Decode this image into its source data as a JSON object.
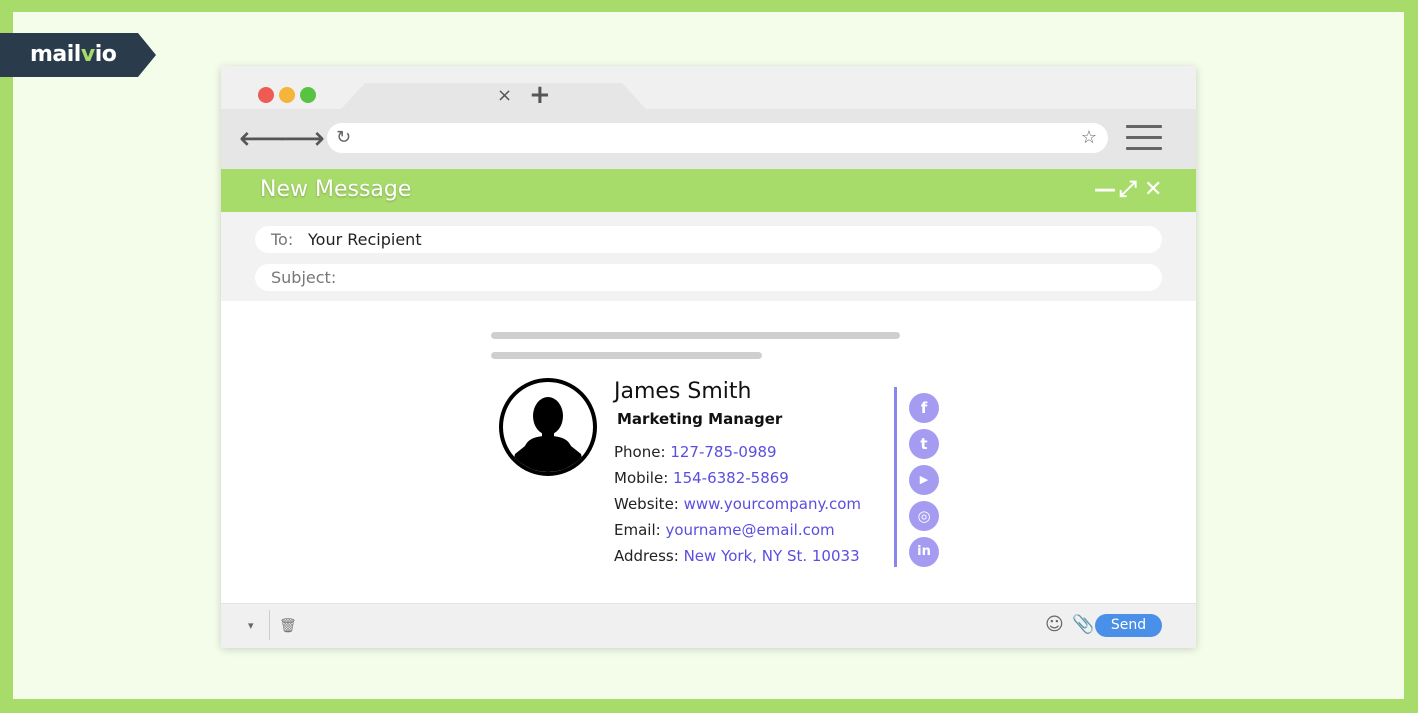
{
  "brand": {
    "logo_text_a": "mail",
    "logo_text_b": "v",
    "logo_text_c": "io"
  },
  "browser": {
    "tab_close": "×",
    "tab_new": "+",
    "back_icon": "arrow-left-icon",
    "forward_icon": "arrow-right-icon",
    "reload_icon": "reload-icon",
    "star_icon": "star-icon",
    "menu_icon": "hamburger-menu-icon"
  },
  "compose": {
    "title": "New Message",
    "minimize": "—",
    "expand": "⤢",
    "close": "✕",
    "to_label": "To:",
    "to_value": "Your Recipient",
    "subject_label": "Subject:",
    "subject_value": ""
  },
  "signature": {
    "name": "James Smith",
    "role": "Marketing Manager",
    "rows": [
      {
        "label": "Phone:",
        "value": "127-785-0989"
      },
      {
        "label": "Mobile:",
        "value": "154-6382-5869"
      },
      {
        "label": "Website:",
        "value": "www.yourcompany.com"
      },
      {
        "label": "Email:",
        "value": "yourname@email.com"
      },
      {
        "label": "Address:",
        "value": "New York, NY St. 10033"
      }
    ],
    "social": [
      {
        "icon": "facebook-icon",
        "glyph": "f"
      },
      {
        "icon": "twitter-icon",
        "glyph": "t"
      },
      {
        "icon": "youtube-icon",
        "glyph": "▶"
      },
      {
        "icon": "instagram-icon",
        "glyph": "◎"
      },
      {
        "icon": "linkedin-icon",
        "glyph": "in"
      }
    ]
  },
  "footer": {
    "send_label": "Send",
    "caret": "▾",
    "trash": "🗑",
    "emoji": "☺",
    "attach": "📎"
  },
  "colors": {
    "accent": "#a8dc6a",
    "link": "#5a4ee0",
    "social": "#a59cf2",
    "send": "#4a90e8",
    "logo_bg": "#2a3b4c"
  }
}
